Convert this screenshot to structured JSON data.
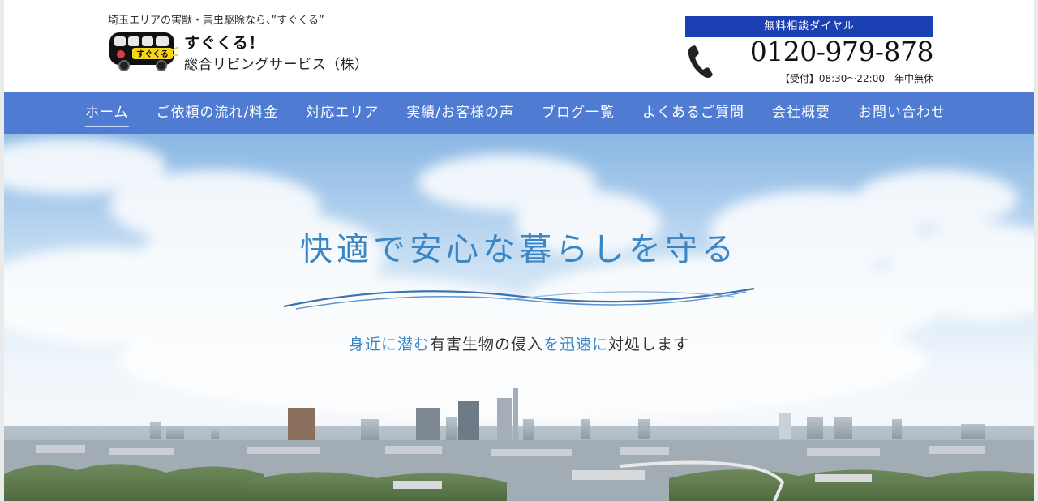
{
  "header": {
    "tagline": "埼玉エリアの害獣・害虫駆除なら、”すぐくる”",
    "logo_text": "すぐくる",
    "brand_name": "すぐくる！",
    "company_name": "総合リビングサービス（株）",
    "dial_label": "無料相談ダイヤル",
    "phone_number": "0120-979-878",
    "hours": "【受付】08:30〜22:00　年中無休"
  },
  "nav": {
    "items": [
      {
        "label": "ホーム",
        "active": true
      },
      {
        "label": "ご依頼の流れ/料金"
      },
      {
        "label": "対応エリア"
      },
      {
        "label": "実績/お客様の声"
      },
      {
        "label": "ブログ一覧"
      },
      {
        "label": "よくあるご質問"
      },
      {
        "label": "会社概要"
      },
      {
        "label": "お問い合わせ"
      }
    ]
  },
  "hero": {
    "catchphrase": "快適で安心な暮らしを守る",
    "sub": {
      "p1": "身近に潜む",
      "p2": "有害生物の侵入",
      "p3": "を迅速に",
      "p4": "対処します"
    }
  },
  "colors": {
    "nav_bg": "#4f7bd3",
    "dial_badge": "#1d3fb4",
    "accent_text": "#3a86c4"
  },
  "icons": {
    "phone": "phone-icon",
    "logo": "bus-logo-icon"
  }
}
